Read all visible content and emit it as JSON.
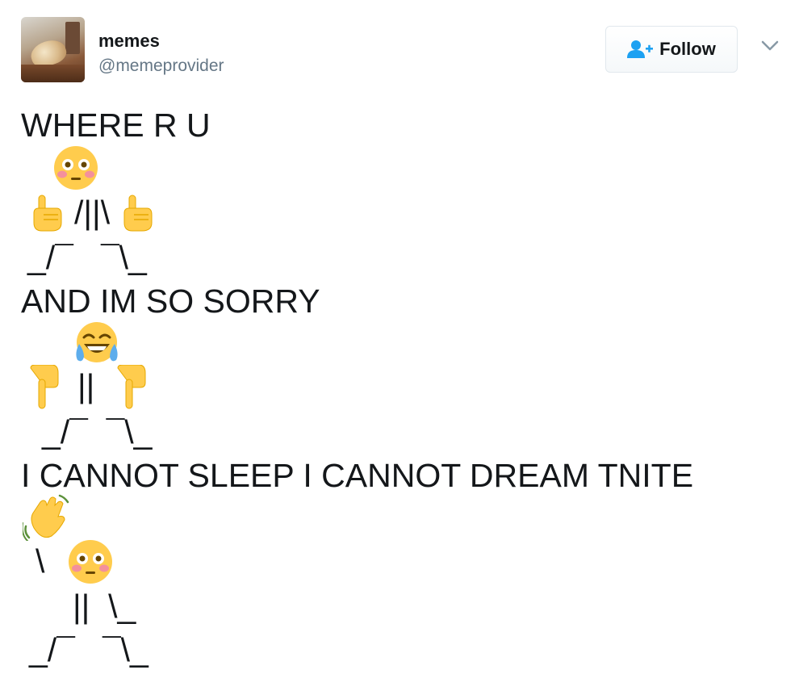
{
  "user": {
    "display_name": "memes",
    "handle": "@memeprovider",
    "avatar_icon": "cat-photo-avatar"
  },
  "actions": {
    "follow_label": "Follow",
    "follow_icon": "add-person-icon",
    "menu_icon": "chevron-down-icon"
  },
  "tweet": {
    "line1": "WHERE R U",
    "line2": "AND IM SO SORRY",
    "line3": "I CANNOT SLEEP I CANNOT DREAM TNITE",
    "fig1_body": "/||\\",
    "fig1_legs": "_/¯   ¯\\_",
    "fig2_body": "||",
    "fig2_legs": "_/¯  ¯\\_",
    "fig3_arm": "\\",
    "fig3_body": "||  \\_",
    "fig3_legs": "_/¯   ¯\\_",
    "emojis": [
      "flushed-face",
      "pointing-up",
      "face-with-tears-of-joy",
      "pointing-down",
      "waving-hand"
    ]
  },
  "colors": {
    "text": "#14171a",
    "secondary": "#657786",
    "accent": "#1da1f2",
    "emoji_yellow": "#ffcc4d"
  }
}
